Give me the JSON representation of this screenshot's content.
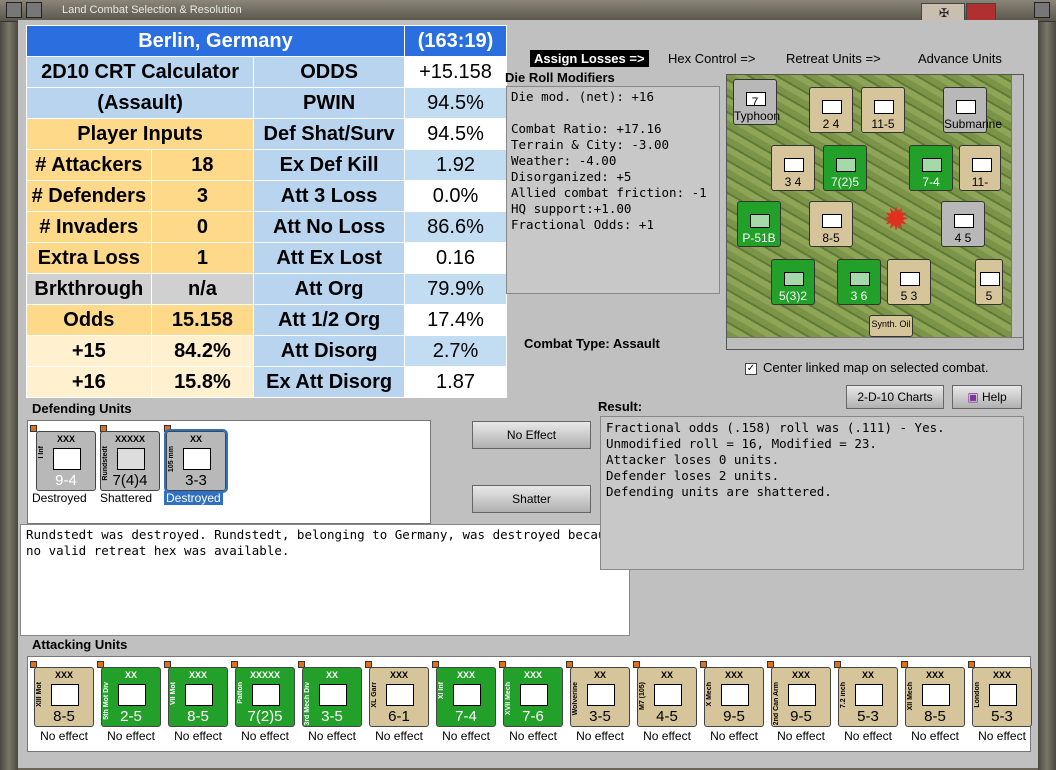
{
  "window": {
    "title": "Land Combat Selection & Resolution"
  },
  "crt": {
    "location": "Berlin, Germany",
    "coords": "(163:19)",
    "calc_title": "2D10 CRT Calculator",
    "calc_sub": "(Assault)",
    "player_inputs": "Player Inputs",
    "rows_left": [
      {
        "label": "# Attackers",
        "value": "18"
      },
      {
        "label": "# Defenders",
        "value": "3"
      },
      {
        "label": "# Invaders",
        "value": "0"
      },
      {
        "label": "Extra Loss",
        "value": "1"
      },
      {
        "label": "Brkthrough",
        "value": "n/a"
      },
      {
        "label": "Odds",
        "value": "15.158"
      },
      {
        "label": "+15",
        "value": "84.2%"
      },
      {
        "label": "+16",
        "value": "15.8%"
      }
    ],
    "rows_right": [
      {
        "label": "ODDS",
        "value": "+15.158"
      },
      {
        "label": "PWIN",
        "value": "94.5%"
      },
      {
        "label": "Def Shat/Surv",
        "value": "94.5%"
      },
      {
        "label": "Ex Def Kill",
        "value": "1.92"
      },
      {
        "label": "Att 3 Loss",
        "value": "0.0%"
      },
      {
        "label": "Att No Loss",
        "value": "86.6%"
      },
      {
        "label": "Att Ex Lost",
        "value": "0.16"
      },
      {
        "label": "Att Org",
        "value": "79.9%"
      },
      {
        "label": "Att 1/2 Org",
        "value": "17.4%"
      },
      {
        "label": "Att Disorg",
        "value": "2.7%"
      },
      {
        "label": "Ex Att Disorg",
        "value": "1.87"
      }
    ]
  },
  "tabs": [
    "Assign Losses =>",
    "Hex Control =>",
    "Retreat Units =>",
    "Advance Units"
  ],
  "die_roll": {
    "title": "Die Roll Modifiers",
    "lines": [
      "Die mod. (net): +16",
      "",
      "Combat Ratio: +17.16",
      "Terrain & City: -3.00",
      "Weather: -4.00",
      "Disorganized: +5",
      "Allied combat friction: -1",
      "HQ support:+1.00",
      "Fractional Odds: +1"
    ]
  },
  "combat_type": "Combat Type:  Assault",
  "center_link": "Center linked map on selected combat.",
  "buttons": {
    "charts": "2-D-10 Charts",
    "help": "Help",
    "no_effect": "No Effect",
    "shatter": "Shatter"
  },
  "defending": {
    "label": "Defending Units",
    "units": [
      {
        "name": "I Inf",
        "size": "XXX",
        "str": "9-4",
        "caption": "Destroyed",
        "color": "gry"
      },
      {
        "name": "Rundstedt",
        "size": "XXXXX",
        "str": "7(4)4",
        "caption": "Shattered",
        "color": "gry"
      },
      {
        "name": "105 mm",
        "size": "XX",
        "str": "3-3",
        "caption": "Destroyed",
        "color": "gry",
        "selected": true
      }
    ]
  },
  "message": "Rundstedt was destroyed.  Rundstedt, belonging to Germany, was destroyed because no valid retreat hex was available.",
  "result": {
    "title": "Result:",
    "lines": [
      "Fractional odds (.158) roll was (.111)  - Yes.",
      "Unmodified roll = 16, Modified = 23.",
      "Attacker loses 0 units.",
      "Defender loses 2 units.",
      "Defending units are shattered."
    ]
  },
  "attacking": {
    "label": "Attacking Units",
    "units": [
      {
        "name": "XIII Mot",
        "size": "XXX",
        "str": "8-5",
        "color": "tan"
      },
      {
        "name": "5th Mot Div",
        "size": "XX",
        "str": "2-5",
        "color": "grn"
      },
      {
        "name": "VII Mot",
        "size": "XXX",
        "str": "8-5",
        "color": "grn"
      },
      {
        "name": "Patton",
        "size": "XXXXX",
        "str": "7(2)5",
        "color": "grn"
      },
      {
        "name": "3rd Mech Div",
        "size": "XX",
        "str": "3-5",
        "color": "grn"
      },
      {
        "name": "XL Garr",
        "size": "XXX",
        "str": "6-1",
        "color": "tan"
      },
      {
        "name": "XI Inf",
        "size": "XXX",
        "str": "7-4",
        "color": "grn"
      },
      {
        "name": "XVII Mech",
        "size": "XXX",
        "str": "7-6",
        "color": "grn"
      },
      {
        "name": "Wolverine",
        "size": "XX",
        "str": "3-5",
        "color": "tan"
      },
      {
        "name": "M7 (105)",
        "size": "XX",
        "str": "4-5",
        "color": "tan"
      },
      {
        "name": "X Mech",
        "size": "XXX",
        "str": "9-5",
        "color": "tan"
      },
      {
        "name": "2nd Can Arm",
        "size": "XXX",
        "str": "9-5",
        "color": "tan"
      },
      {
        "name": "7.2 inch",
        "size": "XX",
        "str": "5-3",
        "color": "tan"
      },
      {
        "name": "XII Mech",
        "size": "XXX",
        "str": "8-5",
        "color": "tan"
      },
      {
        "name": "London",
        "size": "XXX",
        "str": "5-3",
        "color": "tan"
      }
    ],
    "caption": "No effect"
  },
  "map_counters": [
    {
      "lbl": "7 Typhoon"
    },
    {
      "lbl": "2 4"
    },
    {
      "lbl": "11-5"
    },
    {
      "lbl": "Submarine"
    },
    {
      "lbl": "3 4"
    },
    {
      "lbl": "7(2)5"
    },
    {
      "lbl": "7-4"
    },
    {
      "lbl": "11-"
    },
    {
      "lbl": "P-51B"
    },
    {
      "lbl": "8-5"
    },
    {
      "lbl": "4 5"
    },
    {
      "lbl": "5(3)2"
    },
    {
      "lbl": "3 6"
    },
    {
      "lbl": "5 3"
    },
    {
      "lbl": "5"
    },
    {
      "lbl": "Synth. Oil"
    }
  ],
  "colors": {
    "crt_header": "#2a6ee0",
    "crt_input": "#ffd98a",
    "unit_green": "#22a02a",
    "unit_tan": "#d6c49a",
    "unit_grey": "#b8b8b8"
  }
}
